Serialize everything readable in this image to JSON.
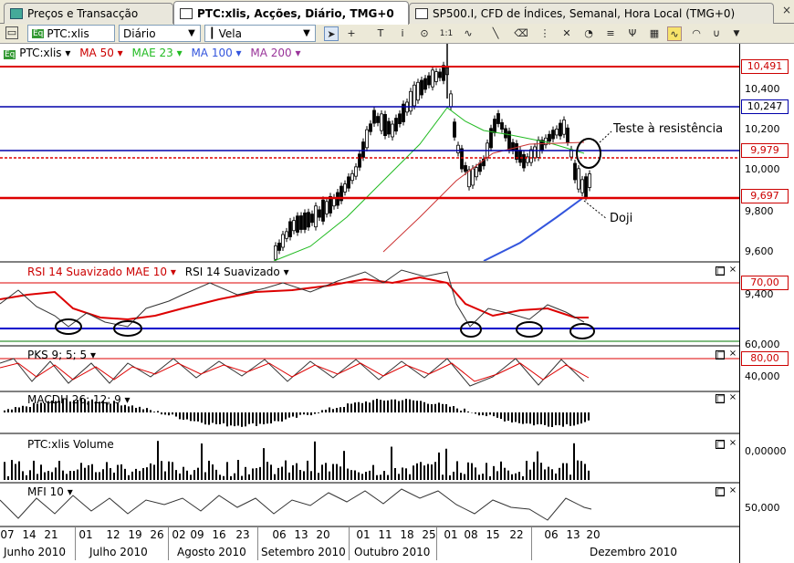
{
  "tabs": [
    {
      "label": "Preços e Transacção",
      "active": false
    },
    {
      "label": "PTC:xlis, Acções, Diário, TMG+0",
      "active": true
    },
    {
      "label": "SP500.I, CFD de Índices, Semanal, Hora Local (TMG+0)",
      "active": false
    }
  ],
  "toolbar": {
    "symbol": "PTC:xlis",
    "period": "Diário",
    "chart_style": "Vela",
    "icons": [
      "cursor-icon",
      "crosshair-icon",
      "text-tool-icon",
      "info-icon",
      "zoom-icon",
      "one-to-one-icon",
      "oscillator-icon",
      "line-tool-icon",
      "eraser-icon",
      "fibonacci-icon",
      "gann-icon",
      "cycle-icon",
      "channel-icon",
      "pitchfork-icon",
      "pattern-icon",
      "magnet-icon"
    ]
  },
  "price_panel": {
    "legend": [
      {
        "label": "PTC:xlis",
        "color": "#000000"
      },
      {
        "label": "MA 50",
        "color": "#cc0000"
      },
      {
        "label": "MAE 23",
        "color": "#22bb22"
      },
      {
        "label": "MA 100",
        "color": "#3355dd"
      },
      {
        "label": "MA 200",
        "color": "#993399"
      }
    ],
    "y_ticks": [
      "10,400",
      "10,200",
      "10,000",
      "9,800",
      "9,600"
    ],
    "levels": [
      {
        "value": "10,491",
        "color": "#dd0000"
      },
      {
        "value": "10,247",
        "color": "#0000aa"
      },
      {
        "value": "9,979",
        "color": "#dd0000"
      },
      {
        "value": "9,697",
        "color": "#dd0000"
      }
    ],
    "annotations": {
      "resistance": "Teste à resistência",
      "doji": "Doji"
    }
  },
  "rsi_panel": {
    "legend": [
      "RSI 14 Suavizado MAE 10",
      "RSI 14 Suavizado"
    ],
    "y_ticks": [
      "70,00",
      "9,400",
      "60,000"
    ]
  },
  "pks_panel": {
    "legend": "PKS 9; 5; 5",
    "y_ticks": [
      "80,00",
      "40,000"
    ]
  },
  "macd_panel": {
    "legend": "MACDH 26; 12; 9"
  },
  "volume_panel": {
    "legend": "PTC:xlis Volume",
    "y_ticks": [
      "0,00000"
    ]
  },
  "mfi_panel": {
    "legend": "MFI 10",
    "y_ticks": [
      "50,000"
    ]
  },
  "date_axis": {
    "days": [
      "07",
      "14",
      "21",
      "01",
      "12",
      "19",
      "26",
      "02",
      "09",
      "16",
      "23",
      "06",
      "13",
      "20",
      "01",
      "11",
      "18",
      "25",
      "01",
      "08",
      "15",
      "22",
      "06",
      "13",
      "20"
    ],
    "months": [
      "Junho 2010",
      "Julho 2010",
      "Agosto 2010",
      "Setembro 2010",
      "Outubro 2010",
      "Dezembro 2010"
    ]
  },
  "panel_buttons": {
    "maximize": "□",
    "close": "×"
  }
}
